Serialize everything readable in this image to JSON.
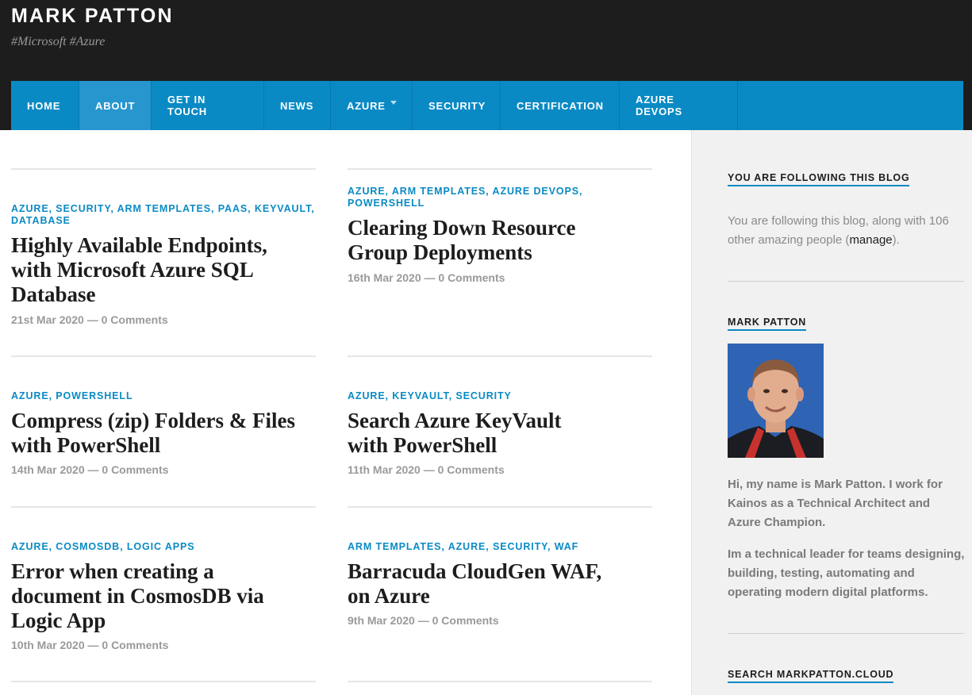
{
  "site": {
    "title": "MARK PATTON",
    "tagline": "#Microsoft #Azure"
  },
  "nav": {
    "items": [
      {
        "label": "HOME"
      },
      {
        "label": "ABOUT"
      },
      {
        "label": "GET IN TOUCH"
      },
      {
        "label": "NEWS"
      },
      {
        "label": "AZURE"
      },
      {
        "label": "SECURITY"
      },
      {
        "label": "CERTIFICATION"
      },
      {
        "label": "AZURE DEVOPS"
      }
    ]
  },
  "posts": [
    {
      "cats": "AZURE, SECURITY, ARM TEMPLATES, PAAS, KEYVAULT, DATABASE",
      "title": "Highly Available Endpoints, with Microsoft Azure SQL Database",
      "date": "21st Mar 2020",
      "comments": "0 Comments"
    },
    {
      "cats": "AZURE, ARM TEMPLATES, AZURE DEVOPS, POWERSHELL",
      "title": "Clearing Down Resource Group Deployments",
      "date": "16th Mar 2020",
      "comments": "0 Comments"
    },
    {
      "cats": "AZURE, POWERSHELL",
      "title": "Compress (zip) Folders & Files with PowerShell",
      "date": "14th Mar 2020",
      "comments": "0 Comments"
    },
    {
      "cats": "AZURE, KEYVAULT, SECURITY",
      "title": "Search Azure KeyVault with PowerShell",
      "date": "11th Mar 2020",
      "comments": "0 Comments"
    },
    {
      "cats": "AZURE, COSMOSDB, LOGIC APPS",
      "title": "Error when creating a document in CosmosDB via Logic App",
      "date": "10th Mar 2020",
      "comments": "0 Comments"
    },
    {
      "cats": "ARM TEMPLATES, AZURE, SECURITY, WAF",
      "title": "Barracuda CloudGen WAF, on Azure",
      "date": "9th Mar 2020",
      "comments": "0 Comments"
    }
  ],
  "meta_separator": "—",
  "sidebar": {
    "follow_title": "YOU ARE FOLLOWING THIS BLOG",
    "follow_text_before": "You are following this blog, along with 106 other amazing people (",
    "follow_link": "manage",
    "follow_text_after": ").",
    "author_title": "MARK PATTON",
    "bio_1": "Hi, my name is Mark Patton. I work for Kainos as a Technical Architect and Azure Champion.",
    "bio_2": "Im a technical leader for teams designing, building, testing, automating and operating modern digital platforms.",
    "search_title": "SEARCH MARKPATTON.CLOUD"
  },
  "colors": {
    "accent": "#0a8ac4",
    "header_bg": "#1d1d1d",
    "sidebar_bg": "#f1f1f1"
  }
}
